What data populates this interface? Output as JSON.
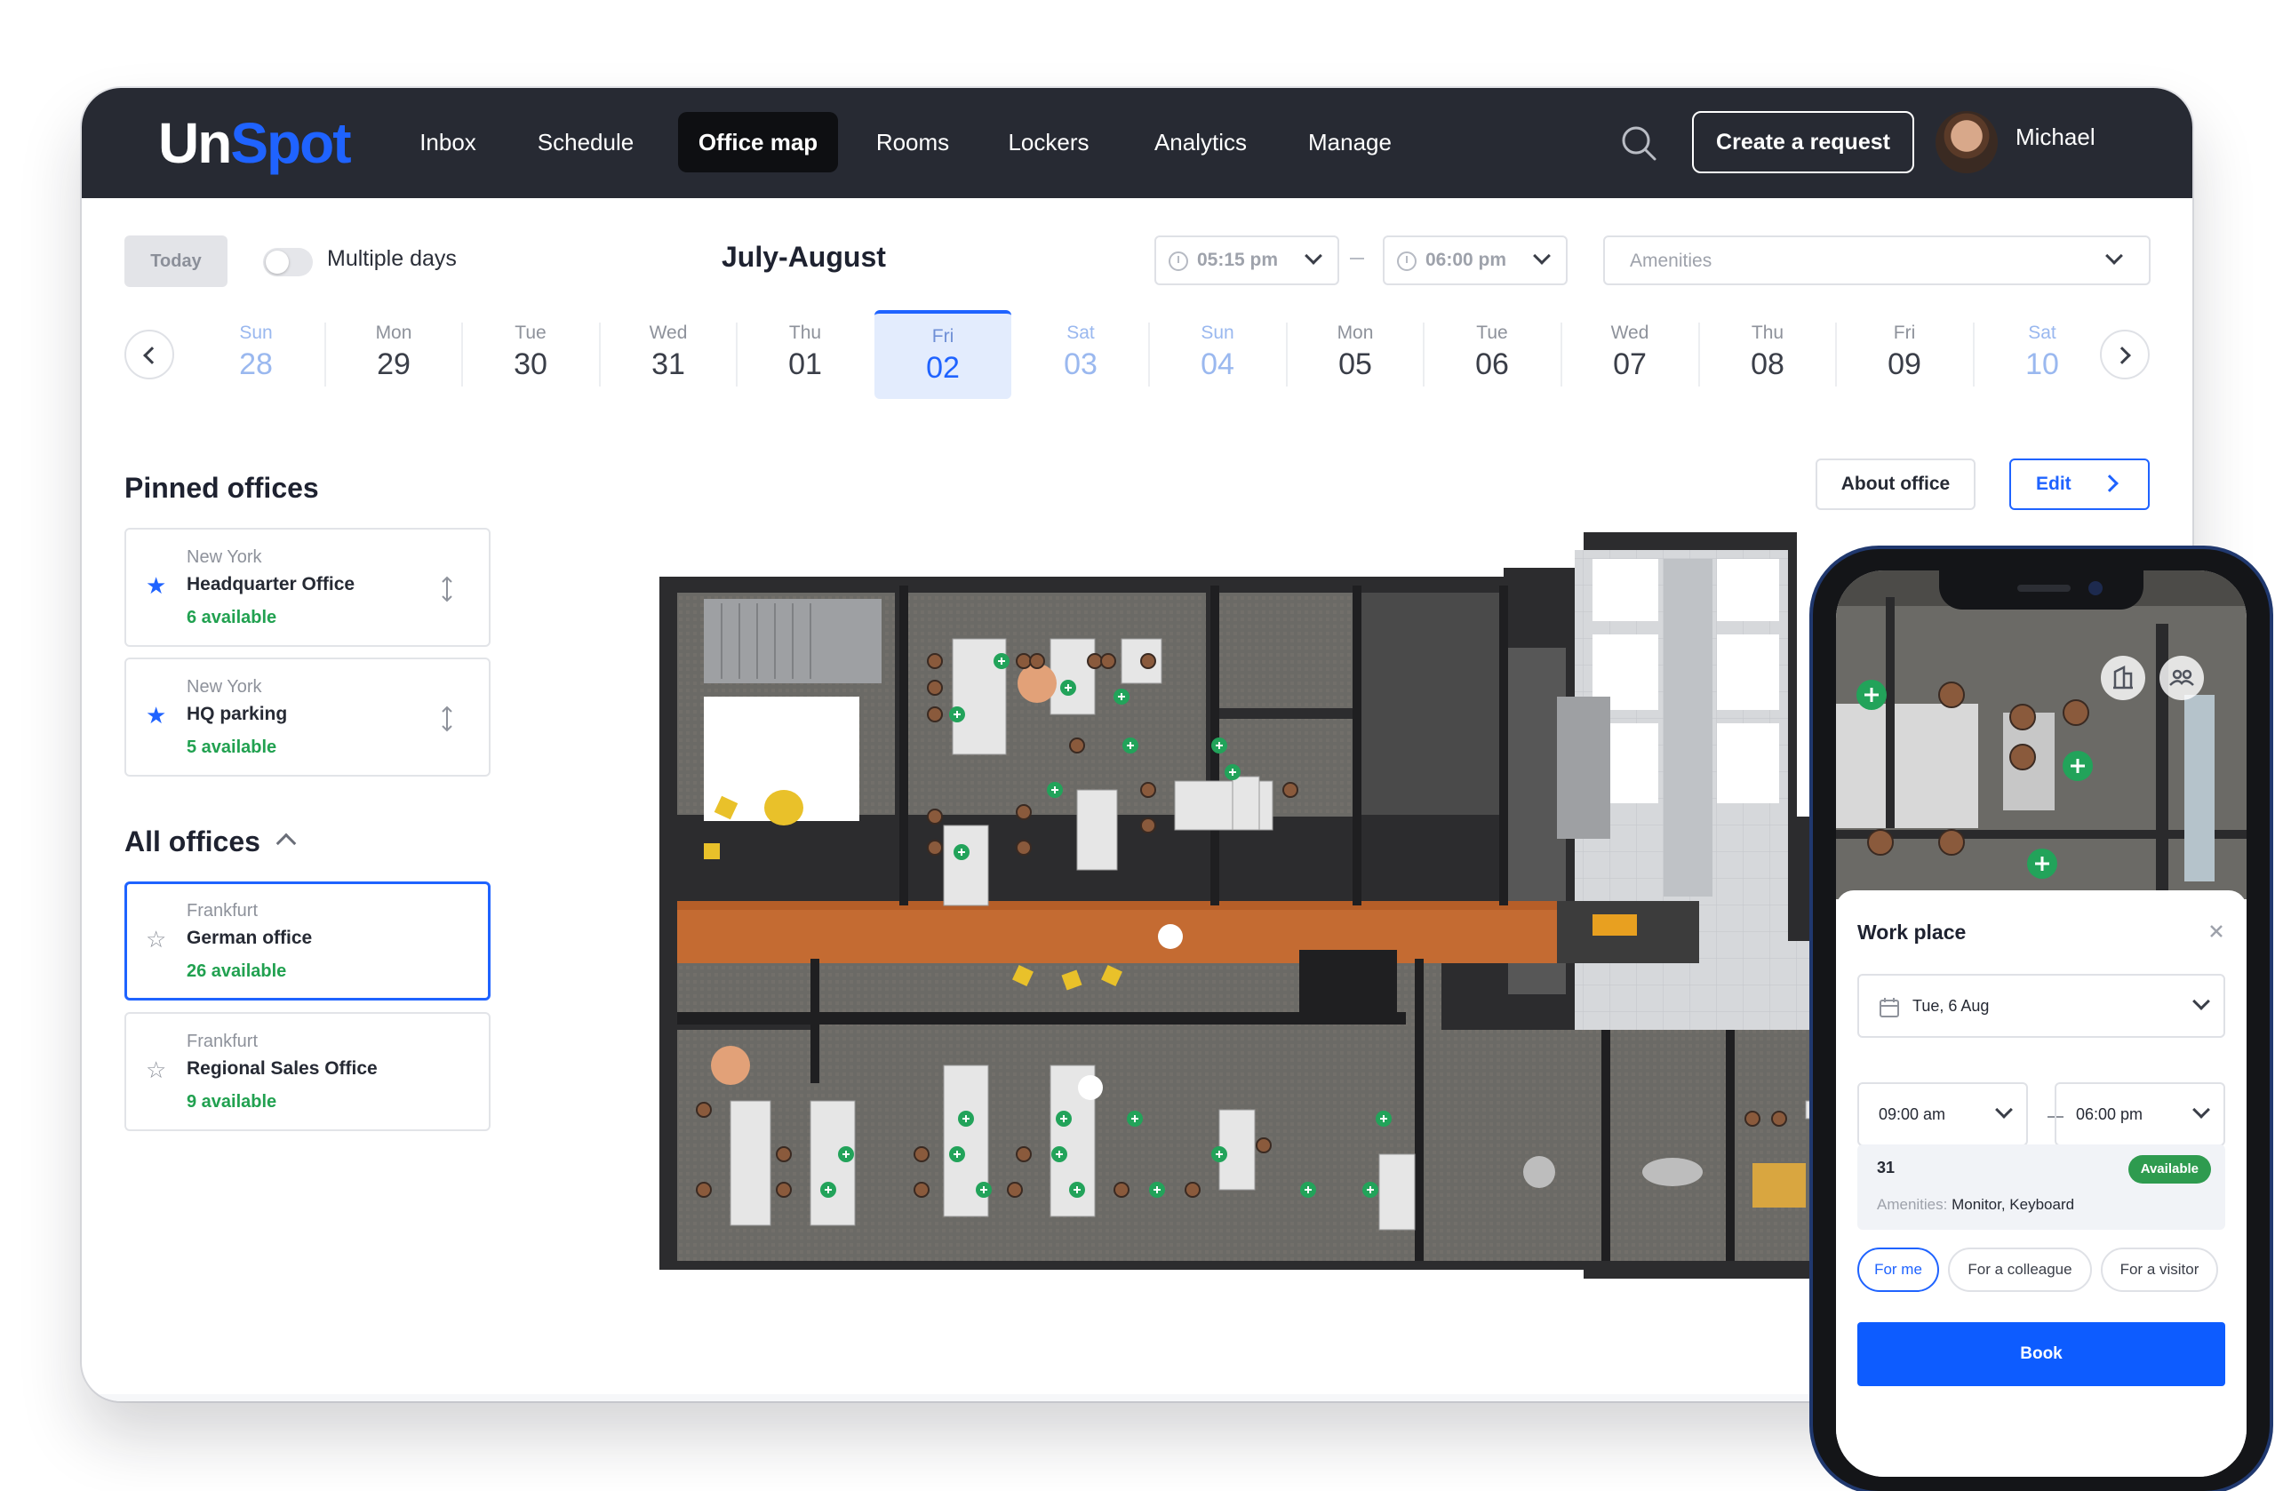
{
  "brand": {
    "logo_part1": "Un",
    "logo_part2": "Spot",
    "accent": "#1f63ff",
    "topbar_bg": "#272a33",
    "available_green": "#21a150"
  },
  "nav": {
    "items": [
      {
        "label": "Inbox"
      },
      {
        "label": "Schedule"
      },
      {
        "label": "Office map",
        "active": true
      },
      {
        "label": "Rooms"
      },
      {
        "label": "Lockers"
      },
      {
        "label": "Analytics"
      },
      {
        "label": "Manage"
      }
    ],
    "search_icon": "search-icon",
    "create_request": "Create a request",
    "user_name": "Michael"
  },
  "filters": {
    "today": "Today",
    "multiple_days": "Multiple days",
    "multiple_days_on": false,
    "period": "July-August",
    "time_from": "05:15 pm",
    "time_to": "06:00 pm",
    "amenities_placeholder": "Amenities"
  },
  "dates": [
    {
      "dow": "Sun",
      "day": "28",
      "weekend": true
    },
    {
      "dow": "Mon",
      "day": "29"
    },
    {
      "dow": "Tue",
      "day": "30"
    },
    {
      "dow": "Wed",
      "day": "31"
    },
    {
      "dow": "Thu",
      "day": "01"
    },
    {
      "dow": "Fri",
      "day": "02",
      "selected": true
    },
    {
      "dow": "Sat",
      "day": "03",
      "weekend": true
    },
    {
      "dow": "Sun",
      "day": "04",
      "weekend": true
    },
    {
      "dow": "Mon",
      "day": "05"
    },
    {
      "dow": "Tue",
      "day": "06"
    },
    {
      "dow": "Wed",
      "day": "07"
    },
    {
      "dow": "Thu",
      "day": "08"
    },
    {
      "dow": "Fri",
      "day": "09"
    },
    {
      "dow": "Sat",
      "day": "10",
      "weekend": true
    }
  ],
  "pinned": {
    "title": "Pinned offices",
    "offices": [
      {
        "city": "New York",
        "name": "Headquarter Office",
        "available": "6 available"
      },
      {
        "city": "New York",
        "name": "HQ parking",
        "available": "5 available"
      }
    ]
  },
  "all_offices": {
    "title": "All offices",
    "offices": [
      {
        "city": "Frankfurt",
        "name": "German office",
        "available": "26 available",
        "selected": true
      },
      {
        "city": "Frankfurt",
        "name": "Regional Sales Office",
        "available": "9 available"
      }
    ]
  },
  "map_actions": {
    "about": "About office",
    "edit": "Edit"
  },
  "phone": {
    "panel_title": "Work place",
    "date": "Tue, 6 Aug",
    "time_from": "09:00 am",
    "time_to": "06:00 pm",
    "seat_number": "31",
    "status": "Available",
    "amenities_key": "Amenities:",
    "amenities_value": "Monitor, Keyboard",
    "book_for": [
      "For me",
      "For a colleague",
      "For a visitor"
    ],
    "book": "Book"
  }
}
